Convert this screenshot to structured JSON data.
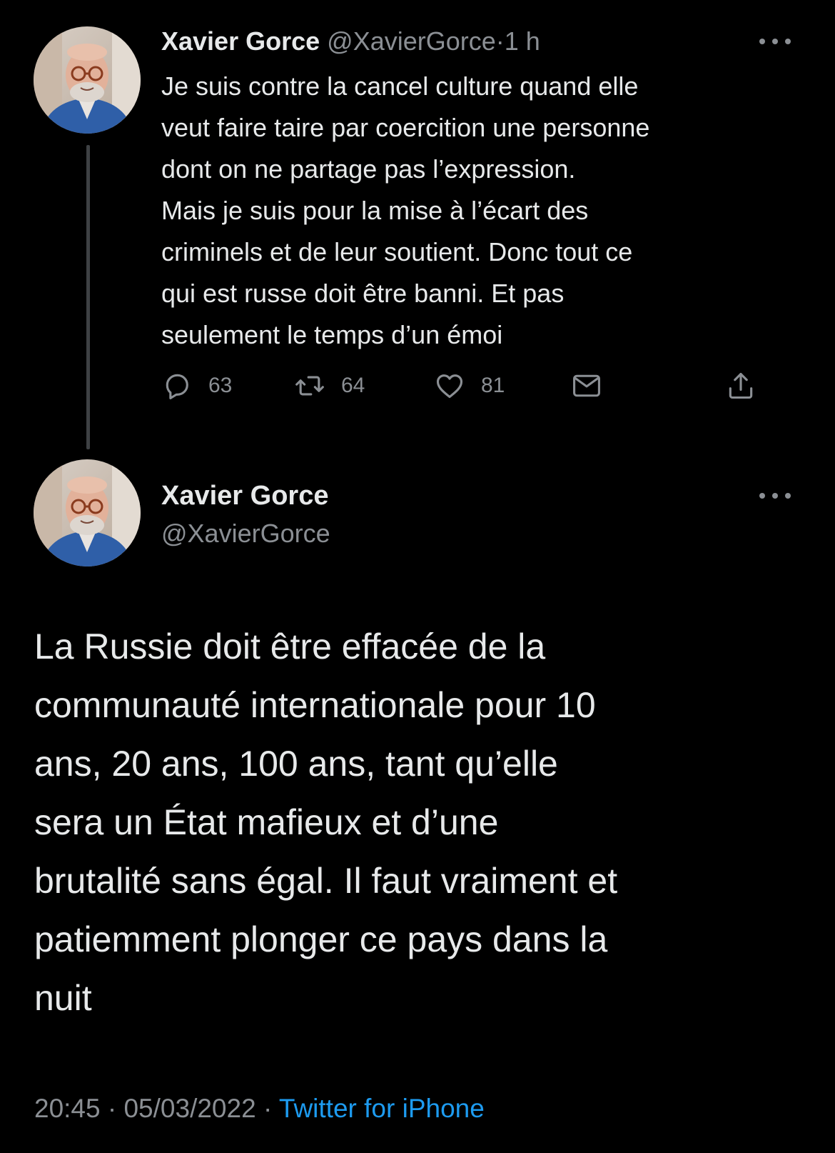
{
  "colors": {
    "background": "#000000",
    "text_primary": "#e7e9ea",
    "text_secondary": "#8b8f94",
    "link": "#1d9bf0",
    "thread_line": "#3e4144"
  },
  "tweet1": {
    "display_name": "Xavier Gorce",
    "handle": "@XavierGorce",
    "separator": "·",
    "time": "1 h",
    "text": "Je suis contre la cancel culture quand elle\nveut faire taire par coercition une personne\ndont on ne partage pas l’expression.\nMais je suis pour la mise à l’écart des\ncriminels et de leur soutient. Donc tout ce\nqui est russe doit être banni. Et pas\nseulement le temps d’un émoi",
    "actions": {
      "reply_icon": "reply-icon",
      "reply_count": "63",
      "retweet_icon": "retweet-icon",
      "retweet_count": "64",
      "like_icon": "heart-icon",
      "like_count": "81",
      "dm_icon": "envelope-icon",
      "share_icon": "share-icon"
    }
  },
  "tweet2": {
    "display_name": "Xavier Gorce",
    "handle": "@XavierGorce",
    "text": "La Russie doit être effacée de la\ncommunauté internationale pour 10\nans, 20 ans, 100 ans, tant qu’elle\nsera un État mafieux et d’une\nbrutalité sans égal. Il faut vraiment et\npatiemment plonger ce pays dans la\nnuit",
    "time": "20:45",
    "separator1": "·",
    "date": "05/03/2022",
    "separator2": "·",
    "source": "Twitter for iPhone"
  }
}
